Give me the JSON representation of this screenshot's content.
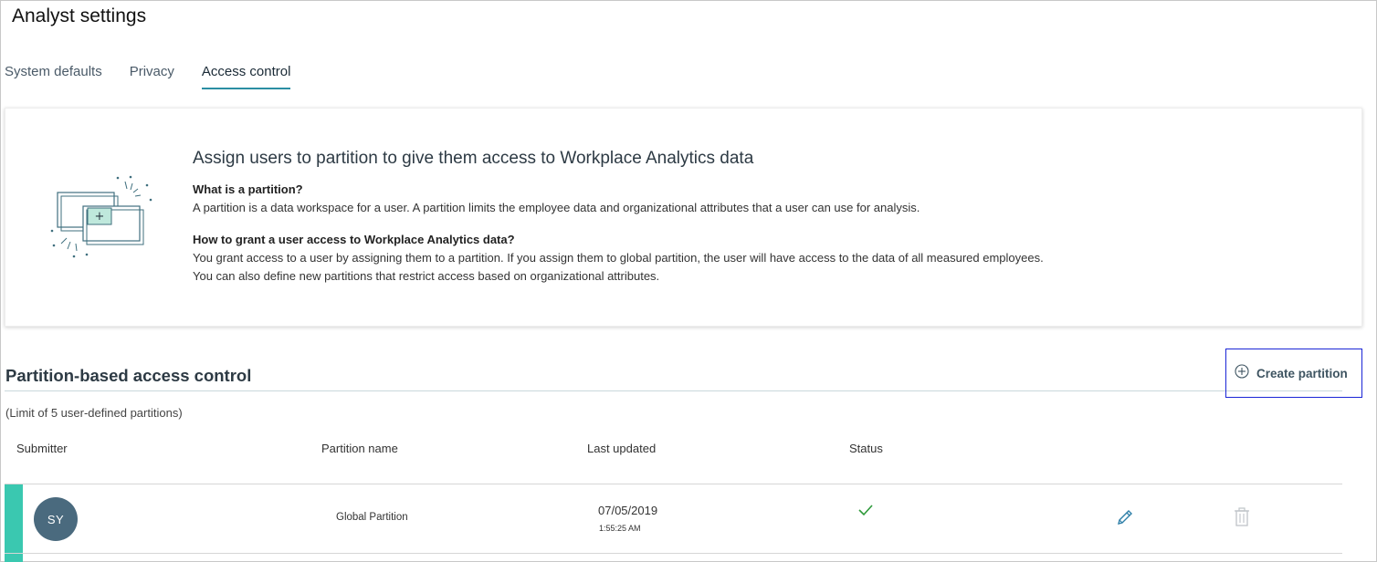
{
  "page": {
    "title": "Analyst settings"
  },
  "tabs": [
    {
      "label": "System defaults",
      "active": false
    },
    {
      "label": "Privacy",
      "active": false
    },
    {
      "label": "Access control",
      "active": true
    }
  ],
  "info": {
    "heading": "Assign users to partition to give them access to Workplace Analytics data",
    "q1": "What is a partition?",
    "a1": "A partition is a data workspace for a user. A partition limits the employee data and organizational attributes that a user can use for analysis.",
    "q2": "How to grant a user access to Workplace Analytics data?",
    "a2_line1": "You grant access to a user by assigning them to a partition. If you assign them to global partition, the user will have access to the data of all measured employees.",
    "a2_line2": "You can also define new partitions that restrict access based on organizational attributes.",
    "illustration_icon": "partition-illustration-icon"
  },
  "section": {
    "title": "Partition-based access control",
    "create_label": "Create partition",
    "limit_note": "(Limit of 5 user-defined partitions)"
  },
  "table": {
    "headers": {
      "submitter": "Submitter",
      "partition_name": "Partition name",
      "last_updated": "Last updated",
      "status": "Status"
    },
    "rows": [
      {
        "submitter_initials": "SY",
        "partition_name": "Global Partition",
        "last_updated_date": "07/05/2019",
        "last_updated_time": "1:55:25 AM",
        "status_icon": "checkmark-icon",
        "edit_icon": "pencil-icon",
        "delete_icon": "trash-icon"
      }
    ]
  },
  "colors": {
    "accent": "#2b8ea3",
    "row_accent": "#3ac8b0",
    "avatar_bg": "#4a6a7e",
    "status_ok": "#2e9a3a",
    "focus_outline": "#1a25d6"
  }
}
